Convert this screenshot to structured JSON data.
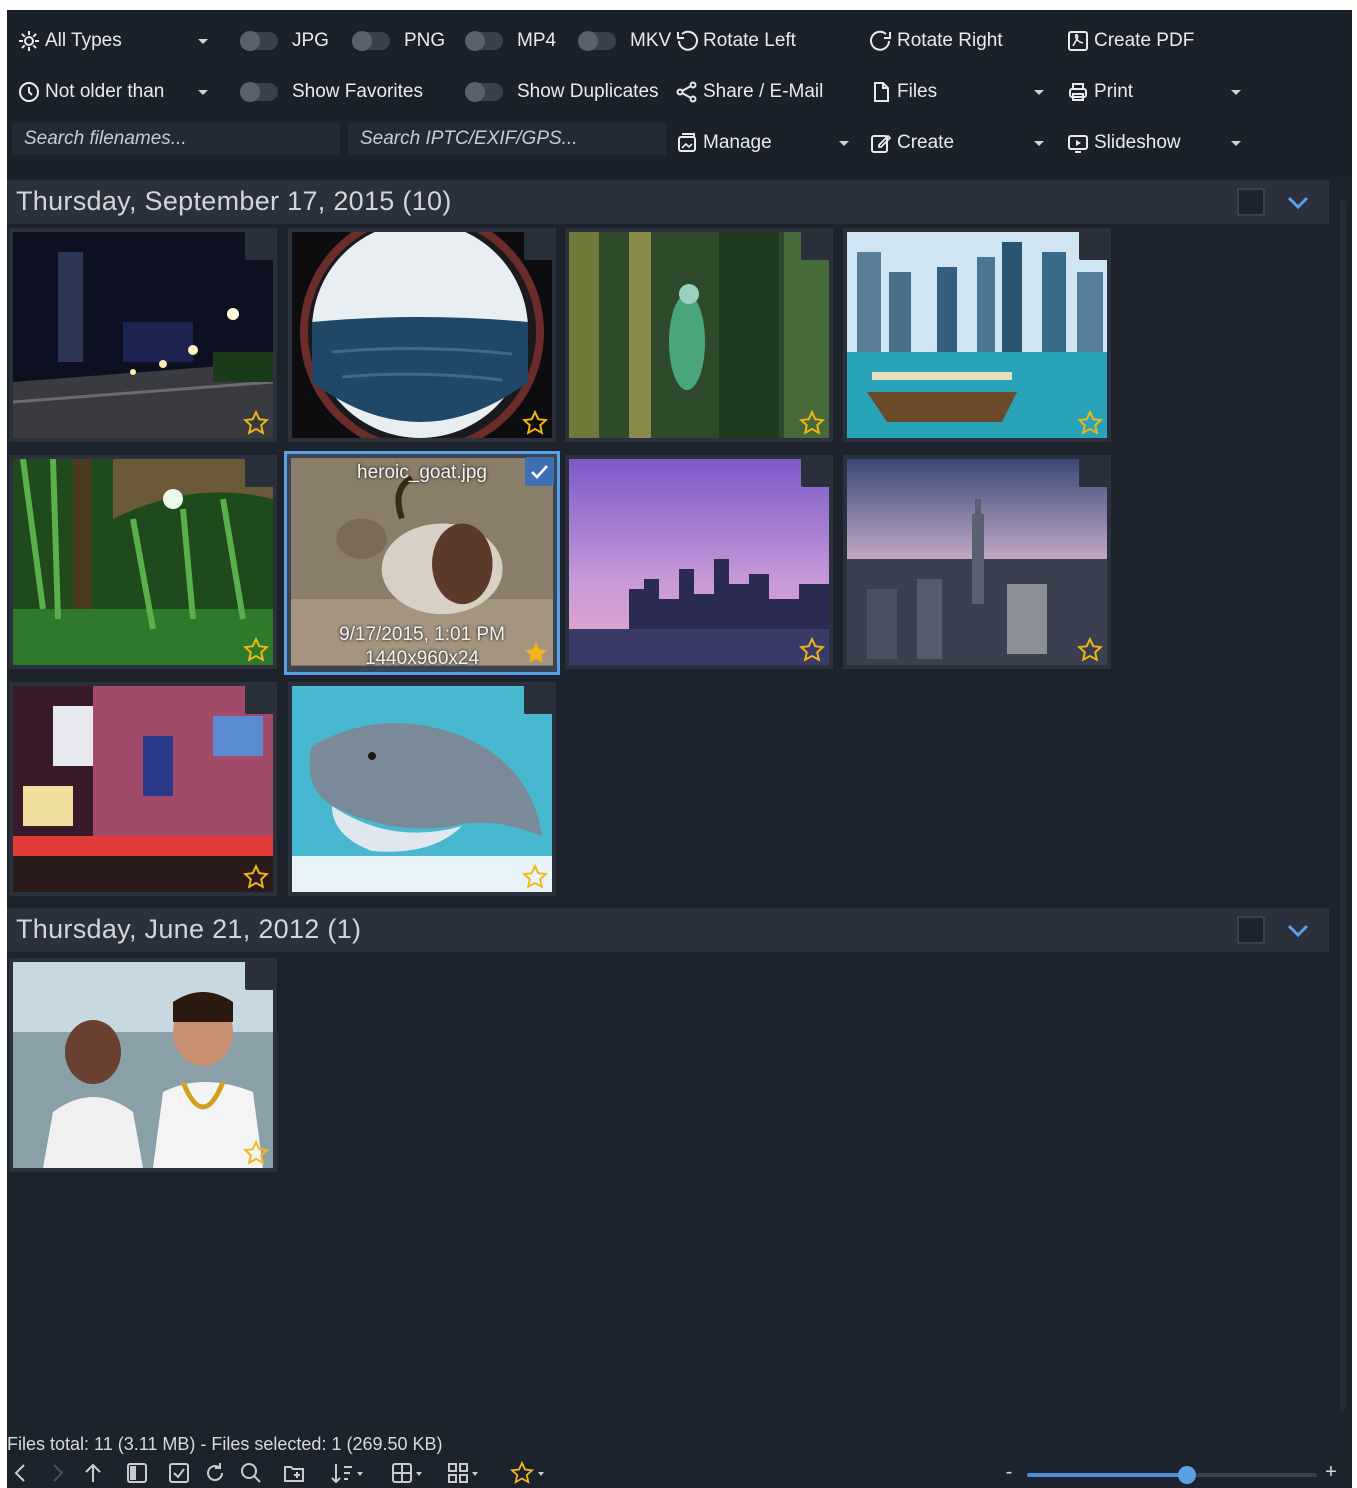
{
  "toolbar": {
    "type_filter": "All Types",
    "toggles": [
      {
        "label": "JPG"
      },
      {
        "label": "PNG"
      },
      {
        "label": "MP4"
      },
      {
        "label": "MKV"
      },
      {
        "label": "Show Favorites"
      },
      {
        "label": "Show Duplicates"
      }
    ],
    "age_filter": "Not older than",
    "search_filenames_placeholder": "Search filenames...",
    "search_meta_placeholder": "Search IPTC/EXIF/GPS...",
    "actions": {
      "rotate_left": "Rotate Left",
      "rotate_right": "Rotate Right",
      "create_pdf": "Create PDF",
      "share": "Share / E-Mail",
      "files": "Files",
      "print": "Print",
      "manage": "Manage",
      "create": "Create",
      "slideshow": "Slideshow"
    }
  },
  "groups": [
    {
      "title": "Thursday, September 17, 2015  (10)",
      "items": [
        {
          "name": "city-night-promenade",
          "favorite": false
        },
        {
          "name": "porthole-sea",
          "favorite": false
        },
        {
          "name": "grasshopper",
          "favorite": false
        },
        {
          "name": "dubai-boat",
          "favorite": false
        },
        {
          "name": "forest-willow",
          "favorite": false
        },
        {
          "name": "heroic-goat",
          "favorite": true,
          "selected": true,
          "filename": "heroic_goat.jpg",
          "date": "9/17/2015, 1:01 PM",
          "dimensions": "1440x960x24"
        },
        {
          "name": "purple-skyline",
          "favorite": false
        },
        {
          "name": "new-york-skyline",
          "favorite": false
        },
        {
          "name": "times-square",
          "favorite": false
        },
        {
          "name": "dolphin",
          "favorite": false
        }
      ]
    },
    {
      "title": "Thursday, June 21, 2012  (1)",
      "items": [
        {
          "name": "beach-couple",
          "favorite": false
        }
      ]
    }
  ],
  "status": {
    "text": "Files total: 11 (3.11 MB) - Files selected: 1 (269.50 KB)",
    "zoom_fraction": 0.55,
    "zoom_minus": "-",
    "zoom_plus": "+"
  },
  "colors": {
    "background": "#1d232d",
    "accent": "#5aa0e6",
    "favorite_star": "#f2b619"
  }
}
